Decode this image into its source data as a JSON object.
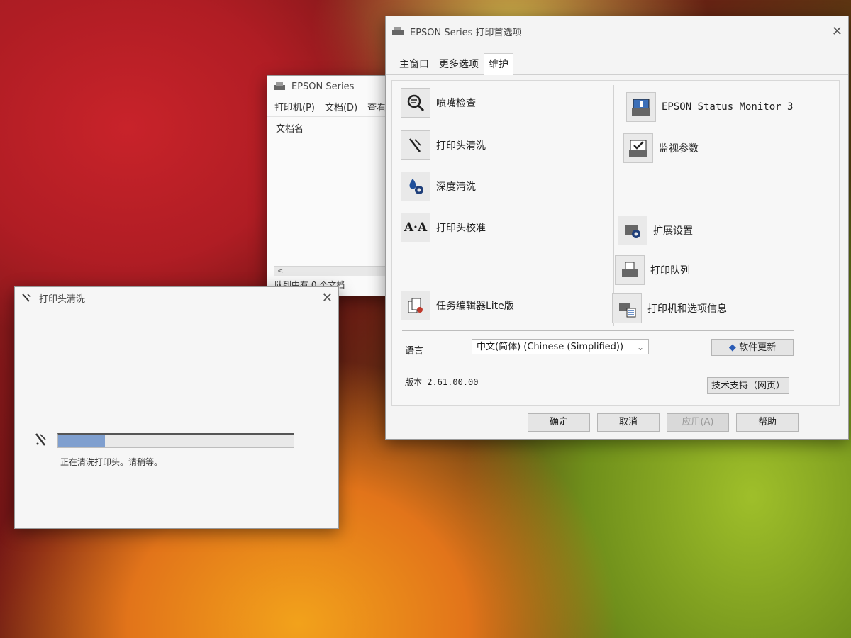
{
  "queue_window": {
    "title": "EPSON Series",
    "menus": [
      "打印机(P)",
      "文档(D)",
      "查看"
    ],
    "column_header": "文档名",
    "scroll_left": "<",
    "status": "队列中有 0 个文档"
  },
  "clean_dialog": {
    "title": "打印头清洗",
    "message": "正在清洗打印头。请稍等。",
    "progress": 0.2
  },
  "prefs_window": {
    "title": "EPSON Series 打印首选项",
    "tabs": [
      "主窗口",
      "更多选项",
      "维护"
    ],
    "active_tab": "维护",
    "left_tools": [
      {
        "label": "喷嘴检查",
        "icon": "nozzle-check-icon"
      },
      {
        "label": "打印头清洗",
        "icon": "head-cleaning-icon"
      },
      {
        "label": "深度清洗",
        "icon": "power-cleaning-icon"
      },
      {
        "label": "打印头校准",
        "icon": "head-alignment-icon"
      },
      {
        "label": "任务编辑器Lite版",
        "icon": "job-arranger-icon"
      }
    ],
    "right_tools": [
      {
        "label": "EPSON Status Monitor 3",
        "icon": "status-monitor-icon"
      },
      {
        "label": "监视参数",
        "icon": "monitoring-preferences-icon"
      },
      {
        "label": "扩展设置",
        "icon": "extended-settings-icon"
      },
      {
        "label": "打印队列",
        "icon": "print-queue-icon"
      },
      {
        "label": "打印机和选项信息",
        "icon": "printer-info-icon"
      }
    ],
    "language_label": "语言",
    "language_value": "中文(简体) (Chinese (Simplified))",
    "software_update": "软件更新",
    "version": "版本 2.61.00.00",
    "tech_support": "技术支持（网页）",
    "buttons": {
      "ok": "确定",
      "cancel": "取消",
      "apply": "应用(A)",
      "help": "帮助"
    }
  }
}
